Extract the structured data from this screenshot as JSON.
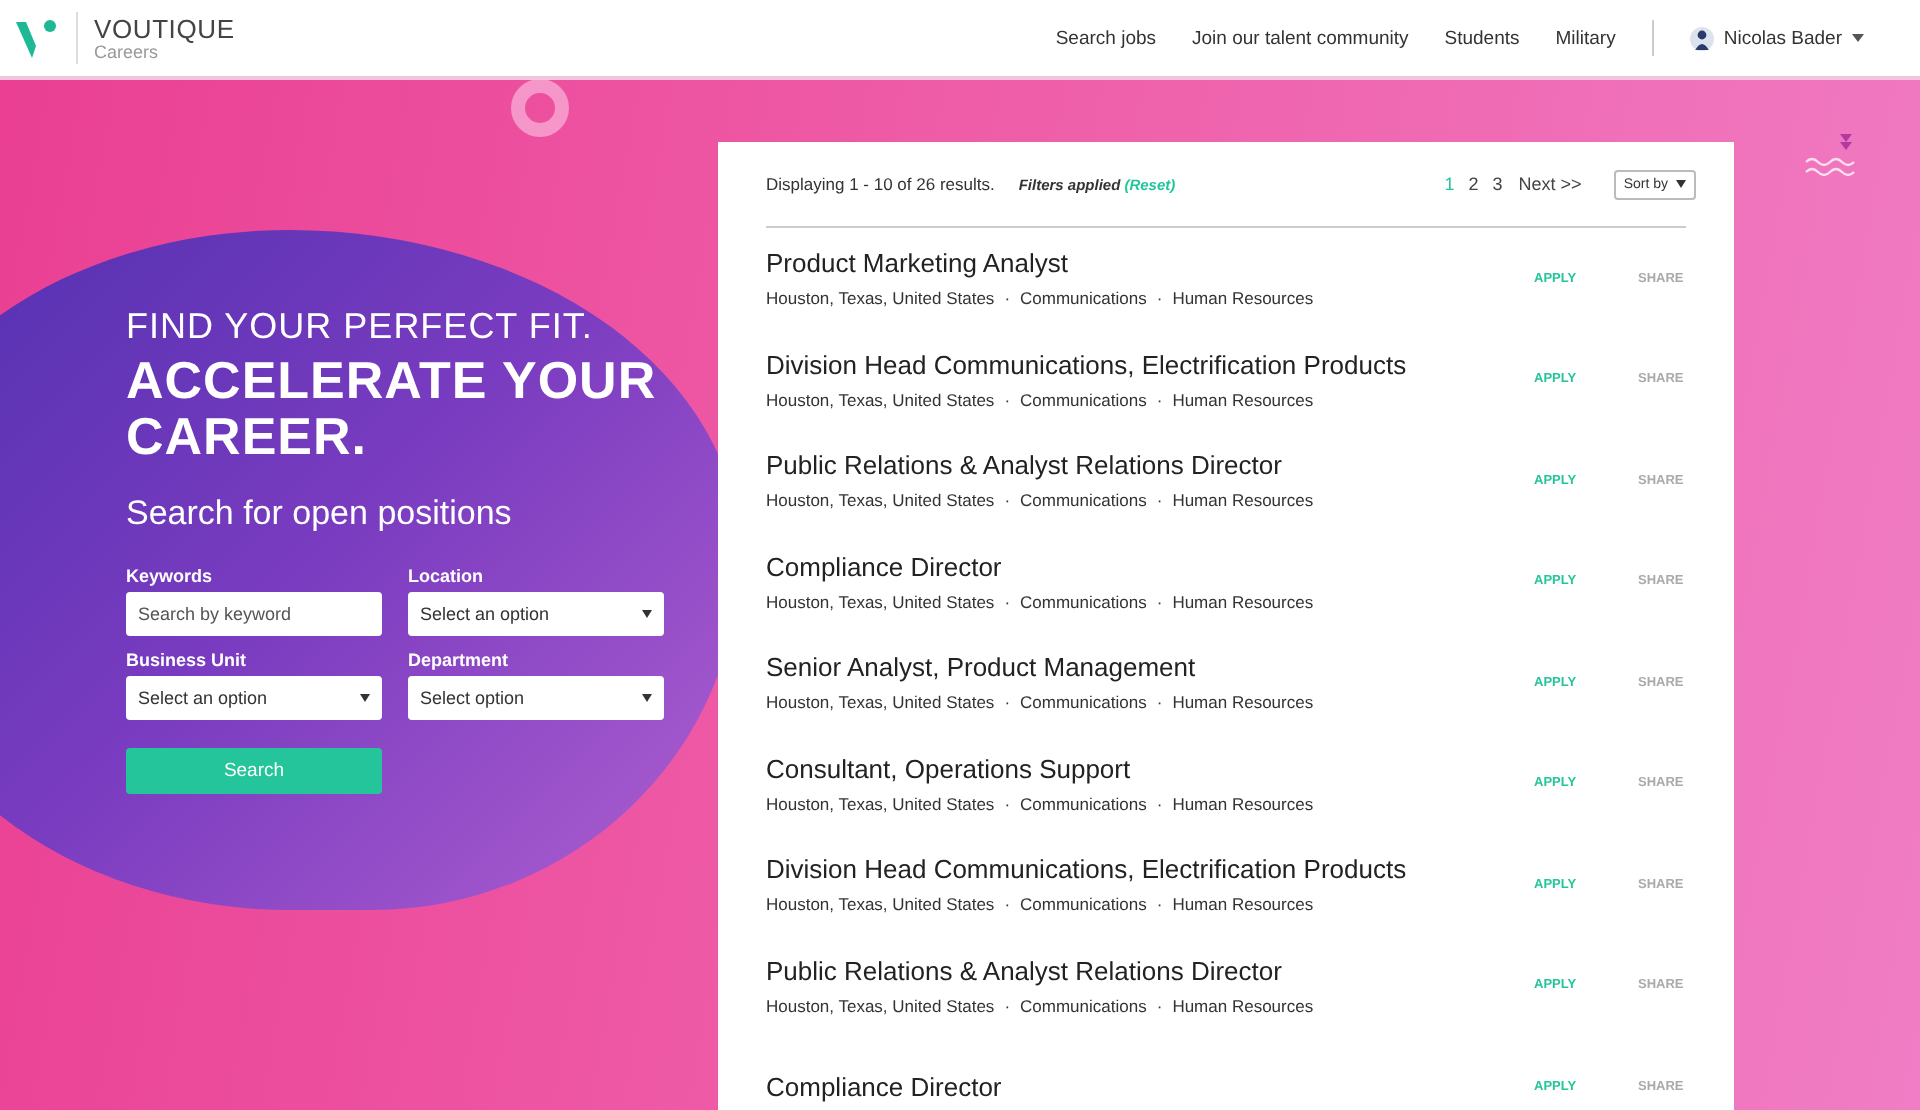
{
  "header": {
    "brand": "VOUTIQUE",
    "subtitle": "Careers",
    "nav": [
      "Search jobs",
      "Join our talent community",
      "Students",
      "Military"
    ],
    "user": "Nicolas Bader"
  },
  "hero": {
    "kicker": "FIND YOUR PERFECT FIT.",
    "headline": "ACCELERATE YOUR CAREER.",
    "subheading": "Search for open positions",
    "fields": [
      {
        "label": "Keywords",
        "kind": "text",
        "placeholder": "Search by keyword"
      },
      {
        "label": "Location",
        "kind": "select",
        "value": "Select an option"
      },
      {
        "label": "Business Unit",
        "kind": "select",
        "value": "Select an option"
      },
      {
        "label": "Department",
        "kind": "select",
        "value": "Select option"
      }
    ],
    "button": "Search"
  },
  "results": {
    "summary": "Displaying 1 - 10 of 26 results.",
    "filters": "Filters applied",
    "reset": "(Reset)",
    "separator": "·",
    "pages": [
      {
        "label": "1",
        "selected": true
      },
      {
        "label": "2",
        "selected": false
      },
      {
        "label": "3",
        "selected": false
      }
    ],
    "next": "Next >>",
    "sort": "Sort by",
    "jobs": [
      {
        "title": "Product Marketing Analyst",
        "location": "Houston, Texas, United States",
        "tags": [
          "Communications",
          "Human Resources"
        ],
        "apply": "APPLY",
        "share": "SHARE"
      },
      {
        "title": "Division Head Communications, Electrification Products",
        "location": "Houston, Texas, United States",
        "tags": [
          "Communications",
          "Human Resources"
        ],
        "apply": "APPLY",
        "share": "SHARE"
      },
      {
        "title": "Public Relations & Analyst Relations Director",
        "location": "Houston, Texas, United States",
        "tags": [
          "Communications",
          "Human Resources"
        ],
        "apply": "APPLY",
        "share": "SHARE"
      },
      {
        "title": "Compliance Director",
        "location": "Houston, Texas, United States",
        "tags": [
          "Communications",
          "Human Resources"
        ],
        "apply": "APPLY",
        "share": "SHARE"
      },
      {
        "title": "Senior Analyst, Product Management",
        "location": "Houston, Texas, United States",
        "tags": [
          "Communications",
          "Human Resources"
        ],
        "apply": "APPLY",
        "share": "SHARE"
      },
      {
        "title": "Consultant, Operations Support",
        "location": "Houston, Texas, United States",
        "tags": [
          "Communications",
          "Human Resources"
        ],
        "apply": "APPLY",
        "share": "SHARE"
      },
      {
        "title": "Division Head Communications, Electrification Products",
        "location": "Houston, Texas, United States",
        "tags": [
          "Communications",
          "Human Resources"
        ],
        "apply": "APPLY",
        "share": "SHARE"
      },
      {
        "title": "Public Relations & Analyst Relations Director",
        "location": "Houston, Texas, United States",
        "tags": [
          "Communications",
          "Human Resources"
        ],
        "apply": "APPLY",
        "share": "SHARE"
      },
      {
        "title": "Compliance Director",
        "apply": "APPLY",
        "share": "SHARE"
      }
    ]
  }
}
